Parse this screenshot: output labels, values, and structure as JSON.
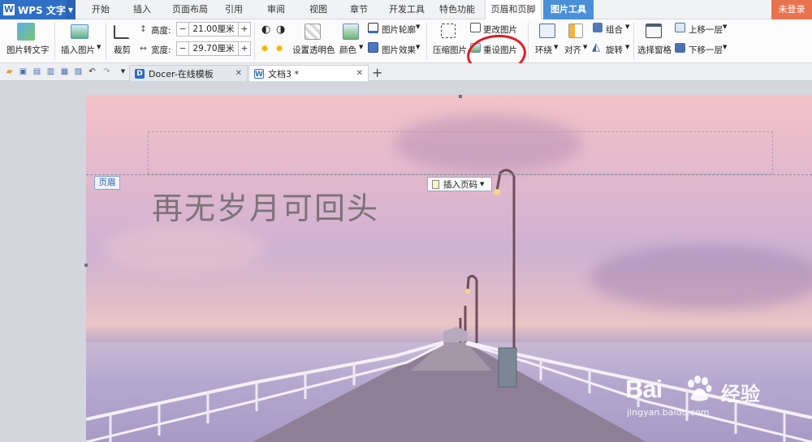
{
  "app": {
    "name": "WPS 文字",
    "logo": "W"
  },
  "menu": {
    "tabs": [
      "开始",
      "插入",
      "页面布局",
      "引用",
      "审阅",
      "视图",
      "章节",
      "开发工具",
      "特色功能",
      "页眉和页脚",
      "图片工具"
    ],
    "login": "未登录"
  },
  "ribbon": {
    "pic_to_text": "图片转文字",
    "insert_pic": "插入图片",
    "crop": "裁剪",
    "height_label": "高度:",
    "height_value": "21.00厘米",
    "width_label": "宽度:",
    "width_value": "29.70厘米",
    "transparent": "设置透明色",
    "color": "颜色",
    "outline": "图片轮廓",
    "effect": "图片效果",
    "compress": "压缩图片",
    "change_pic": "更改图片",
    "reset_pic": "重设图片",
    "wrap": "环绕",
    "align": "对齐",
    "group": "组合",
    "rotate": "旋转",
    "selection_pane": "选择窗格",
    "bring_forward": "上移一层",
    "send_backward": "下移一层"
  },
  "doc_tabs": [
    {
      "label": "Docer-在线模板"
    },
    {
      "label": "文档3 *"
    }
  ],
  "document": {
    "header_tag": "页眉",
    "insert_page_number": "插入页码",
    "headline": "再无岁月可回头"
  },
  "watermark": {
    "brand": "Bai  ",
    "brand_cn": "经验",
    "url": "jingyan.baidu.com"
  },
  "colors": {
    "wps_blue": "#2f6fc6",
    "picture_tools_tab": "#4a90d9",
    "login_orange": "#e8734f",
    "annotation_red": "#e11d22"
  }
}
